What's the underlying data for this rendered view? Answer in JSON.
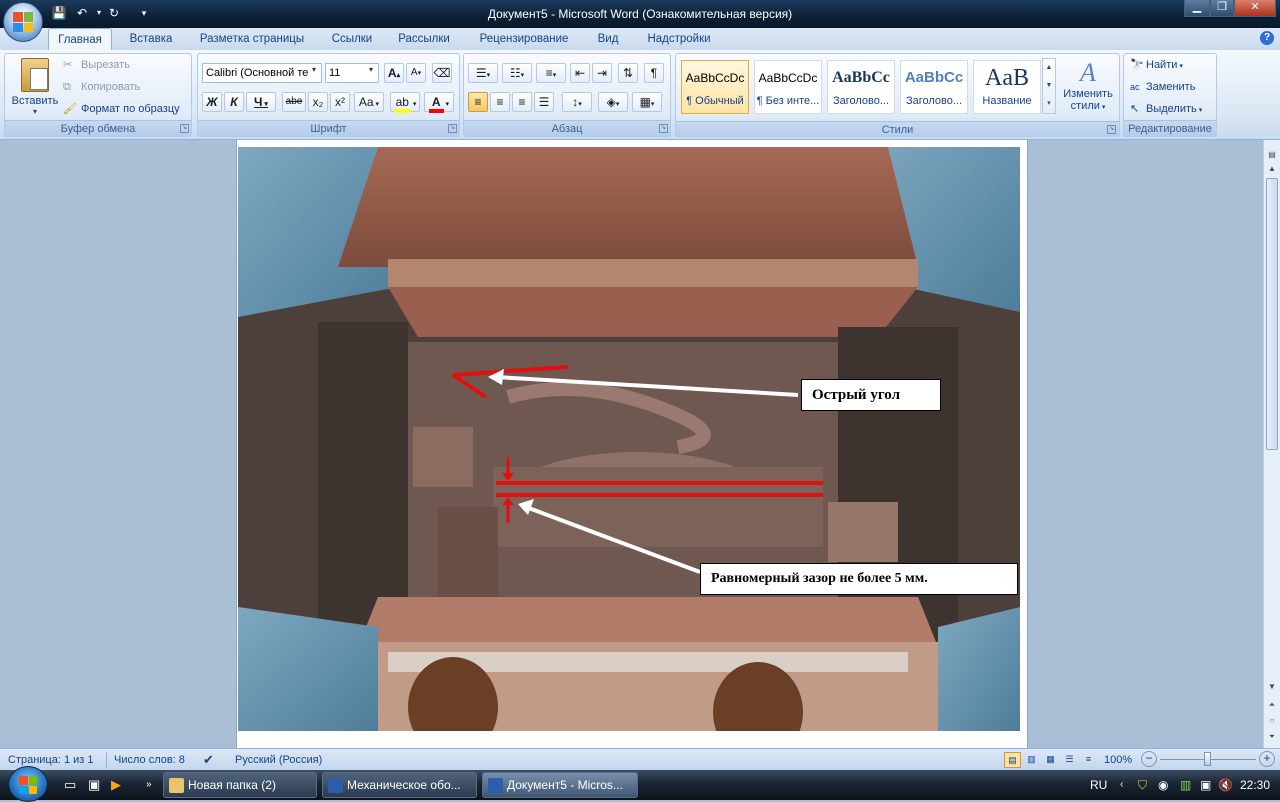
{
  "window": {
    "title": "Документ5 - Microsoft Word (Ознакомительная версия)",
    "controls": [
      "minimize-icon",
      "maximize-icon",
      "close-icon"
    ]
  },
  "tabs": [
    {
      "label": "Главная",
      "active": true
    },
    {
      "label": "Вставка"
    },
    {
      "label": "Разметка страницы"
    },
    {
      "label": "Ссылки"
    },
    {
      "label": "Рассылки"
    },
    {
      "label": "Рецензирование"
    },
    {
      "label": "Вид"
    },
    {
      "label": "Надстройки"
    }
  ],
  "clipboard": {
    "title": "Буфер обмена",
    "paste": "Вставить",
    "cut": "Вырезать",
    "copy": "Копировать",
    "format_painter": "Формат по образцу"
  },
  "font": {
    "title": "Шрифт",
    "family": "Calibri (Основной те",
    "size": "11",
    "bold": "Ж",
    "italic": "К",
    "underline": "Ч",
    "strike": "abe",
    "subscript": "x₂",
    "superscript": "x²",
    "change_case": "Aa",
    "grow": "A",
    "shrink": "A"
  },
  "paragraph": {
    "title": "Абзац"
  },
  "styles": {
    "title": "Стили",
    "items": [
      {
        "preview": "AaBbCcDc",
        "name": "¶ Обычный"
      },
      {
        "preview": "AaBbCcDc",
        "name": "¶ Без инте..."
      },
      {
        "preview": "AaBbCc",
        "name": "Заголово..."
      },
      {
        "preview": "AaBbCc",
        "name": "Заголово..."
      },
      {
        "preview": "AaB",
        "name": "Название"
      }
    ],
    "change_line1": "Изменить",
    "change_line2": "стили"
  },
  "editing": {
    "title": "Редактирование",
    "find": "Найти",
    "replace": "Заменить",
    "select": "Выделить"
  },
  "document": {
    "callout1": "Острый угол",
    "callout2": "Равномерный зазор не более 5 мм."
  },
  "statusbar": {
    "page": "Страница: 1 из 1",
    "words": "Число слов: 8",
    "language": "Русский (Россия)",
    "zoom": "100%"
  },
  "taskbar": {
    "tasks": [
      {
        "label": "Новая папка (2)"
      },
      {
        "label": "Механическое обо..."
      },
      {
        "label": "Документ5 - Micros..."
      }
    ],
    "lang": "RU",
    "time": "22:30"
  },
  "colors": {
    "ribbon_text": "#15428b",
    "highlight": "#ffff00",
    "font_color": "#ff0000",
    "marker_red": "#e01010"
  }
}
